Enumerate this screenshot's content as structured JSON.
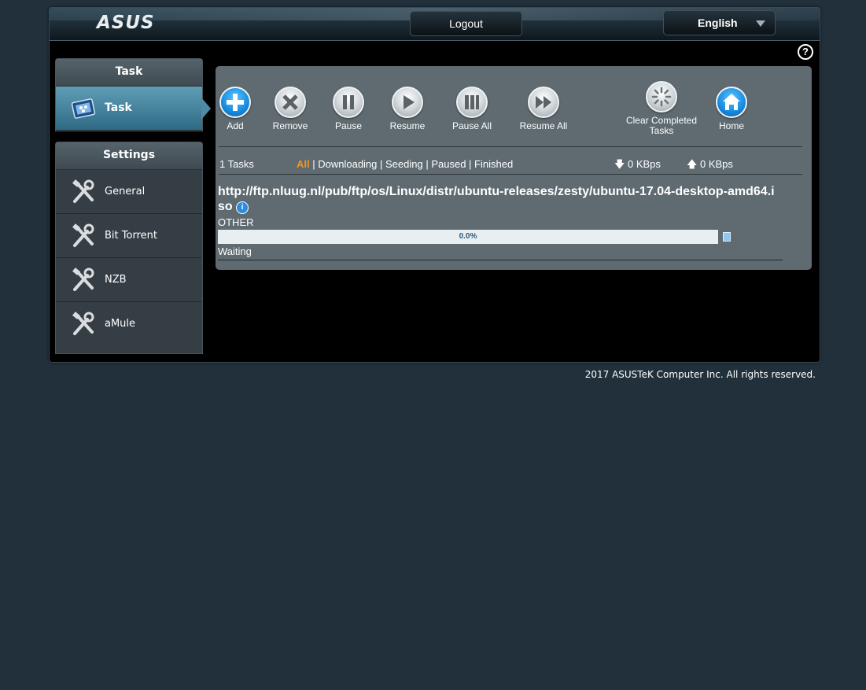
{
  "header": {
    "logo": "ASUS",
    "logout_label": "Logout",
    "language": "English",
    "help_glyph": "?"
  },
  "sidebar": {
    "task_section": {
      "title": "Task",
      "items": [
        {
          "label": "Task",
          "icon": "task-icon",
          "active": true
        }
      ]
    },
    "settings_section": {
      "title": "Settings",
      "items": [
        {
          "label": "General",
          "icon": "wrench-icon"
        },
        {
          "label": "Bit Torrent",
          "icon": "wrench-icon"
        },
        {
          "label": "NZB",
          "icon": "wrench-icon"
        },
        {
          "label": "aMule",
          "icon": "wrench-icon"
        }
      ]
    }
  },
  "toolbar": {
    "add": "Add",
    "remove": "Remove",
    "pause": "Pause",
    "resume": "Resume",
    "pause_all": "Pause All",
    "resume_all": "Resume All",
    "clear_completed_line1": "Clear Completed",
    "clear_completed_line2": "Tasks",
    "home": "Home"
  },
  "status_bar": {
    "task_count": "1 Tasks",
    "filters": [
      "All",
      "Downloading",
      "Seeding",
      "Paused",
      "Finished"
    ],
    "selected_filter": "All",
    "download_speed": "0 KBps",
    "upload_speed": "0 KBps"
  },
  "tasks": [
    {
      "url": "http://ftp.nluug.nl/pub/ftp/os/Linux/distr/ubuntu-releases/zesty/ubuntu-17.04-desktop-amd64.iso",
      "type": "OTHER",
      "progress_text": "0.0%",
      "progress": 0.0,
      "status": "Waiting"
    }
  ],
  "footer": "2017 ASUSTeK Computer Inc. All rights reserved.",
  "colors": {
    "page_bg": "#21303b",
    "accent_orange": "#f7941d",
    "active_item": "#4f8aa4",
    "panel_bg": "#5f6b71"
  }
}
